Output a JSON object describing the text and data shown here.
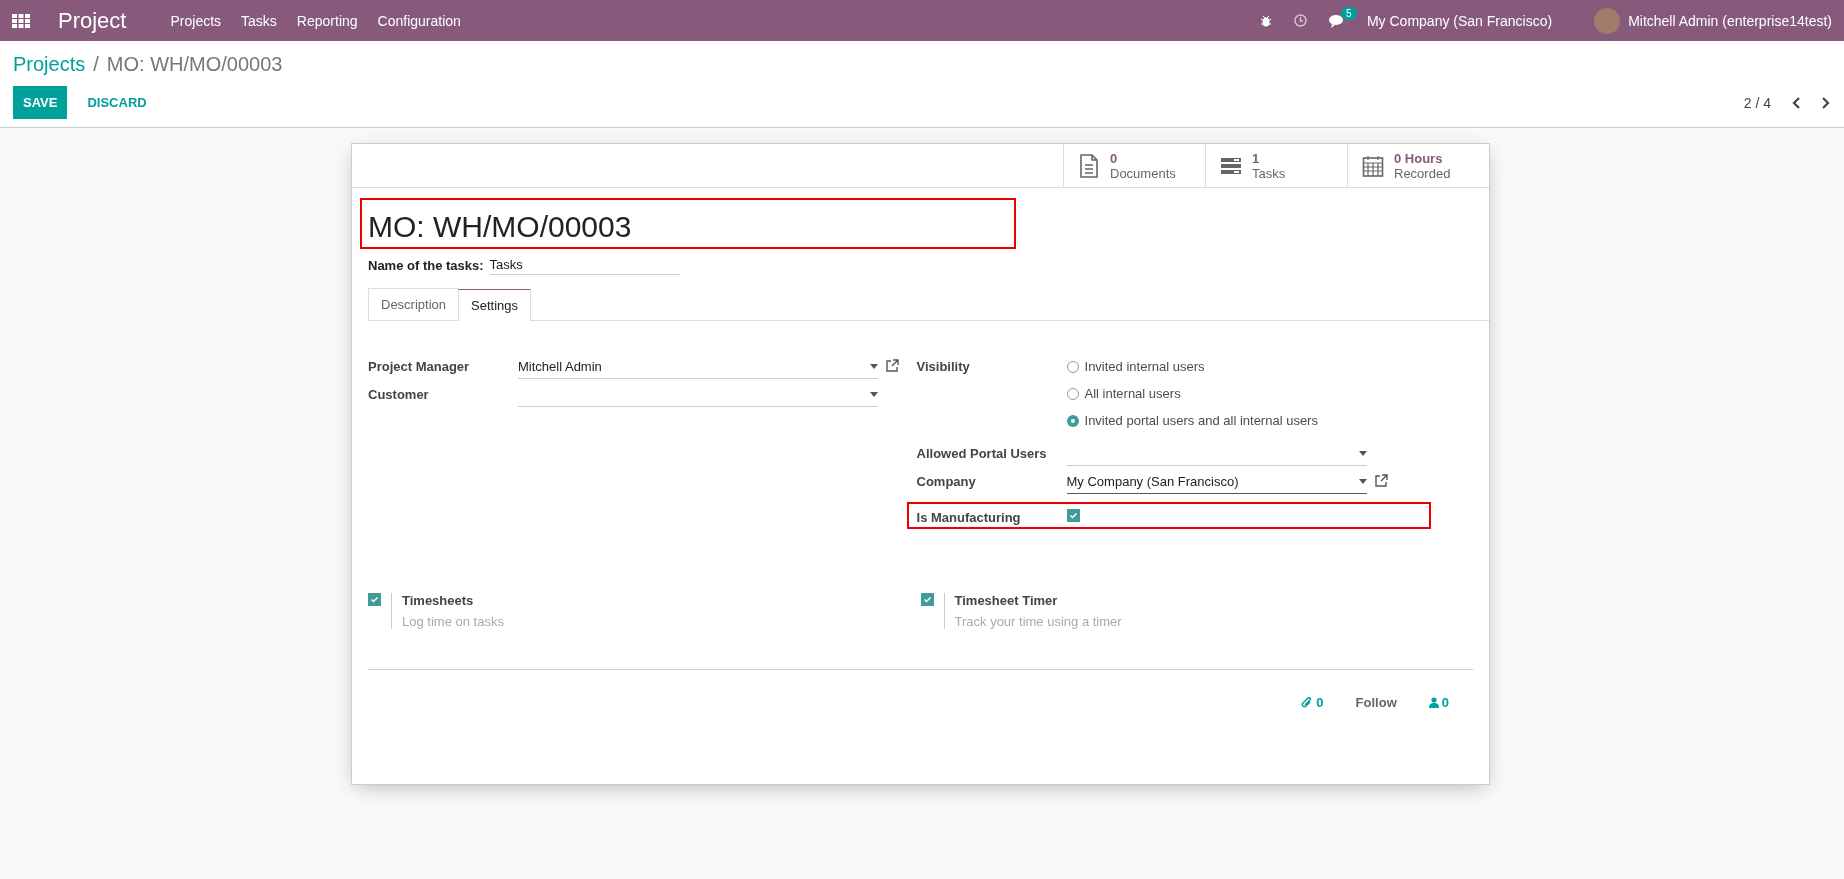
{
  "navbar": {
    "app_title": "Project",
    "menu": [
      "Projects",
      "Tasks",
      "Reporting",
      "Configuration"
    ],
    "message_count": "5",
    "company": "My Company (San Francisco)",
    "user": "Mitchell Admin (enterprise14test)"
  },
  "breadcrumb": {
    "parent": "Projects",
    "separator": "/",
    "current": "MO: WH/MO/00003"
  },
  "actions": {
    "save": "SAVE",
    "discard": "DISCARD",
    "pager": "2 / 4"
  },
  "stat_buttons": [
    {
      "kind": "document",
      "value": "0",
      "label": "Documents"
    },
    {
      "kind": "tasks",
      "value": "1",
      "label": "Tasks"
    },
    {
      "kind": "calendar",
      "value": "0 Hours",
      "label": "Recorded"
    }
  ],
  "title": {
    "value": "MO: WH/MO/00003"
  },
  "task_name": {
    "label": "Name of the tasks:",
    "value": "Tasks"
  },
  "tabs": [
    {
      "label": "Description",
      "selected": false
    },
    {
      "label": "Settings",
      "selected": true
    }
  ],
  "left_fields": [
    {
      "label": "Project Manager",
      "value": "Mitchell Admin",
      "external_link": true
    },
    {
      "label": "Customer",
      "external_link": false
    }
  ],
  "visibility": {
    "label": "Visibility",
    "options": [
      {
        "label": "Invited internal users",
        "selected": false
      },
      {
        "label": "All internal users",
        "selected": false
      },
      {
        "label": "Invited portal users and all internal users",
        "selected": true
      }
    ]
  },
  "right_fields": [
    {
      "label": "Allowed Portal Users",
      "external_link": false
    },
    {
      "label": "Company",
      "value": "My Company (San Francisco)",
      "external_link": true
    }
  ],
  "is_manufacturing": {
    "label": "Is Manufacturing",
    "checked": true
  },
  "settings": [
    {
      "title": "Timesheets",
      "description": "Log time on tasks",
      "checked": true
    },
    {
      "title": "Timesheet Timer",
      "description": "Track your time using a timer",
      "checked": true
    }
  ],
  "chatter": {
    "attachments": "0",
    "follow": "Follow",
    "followers": "0"
  }
}
